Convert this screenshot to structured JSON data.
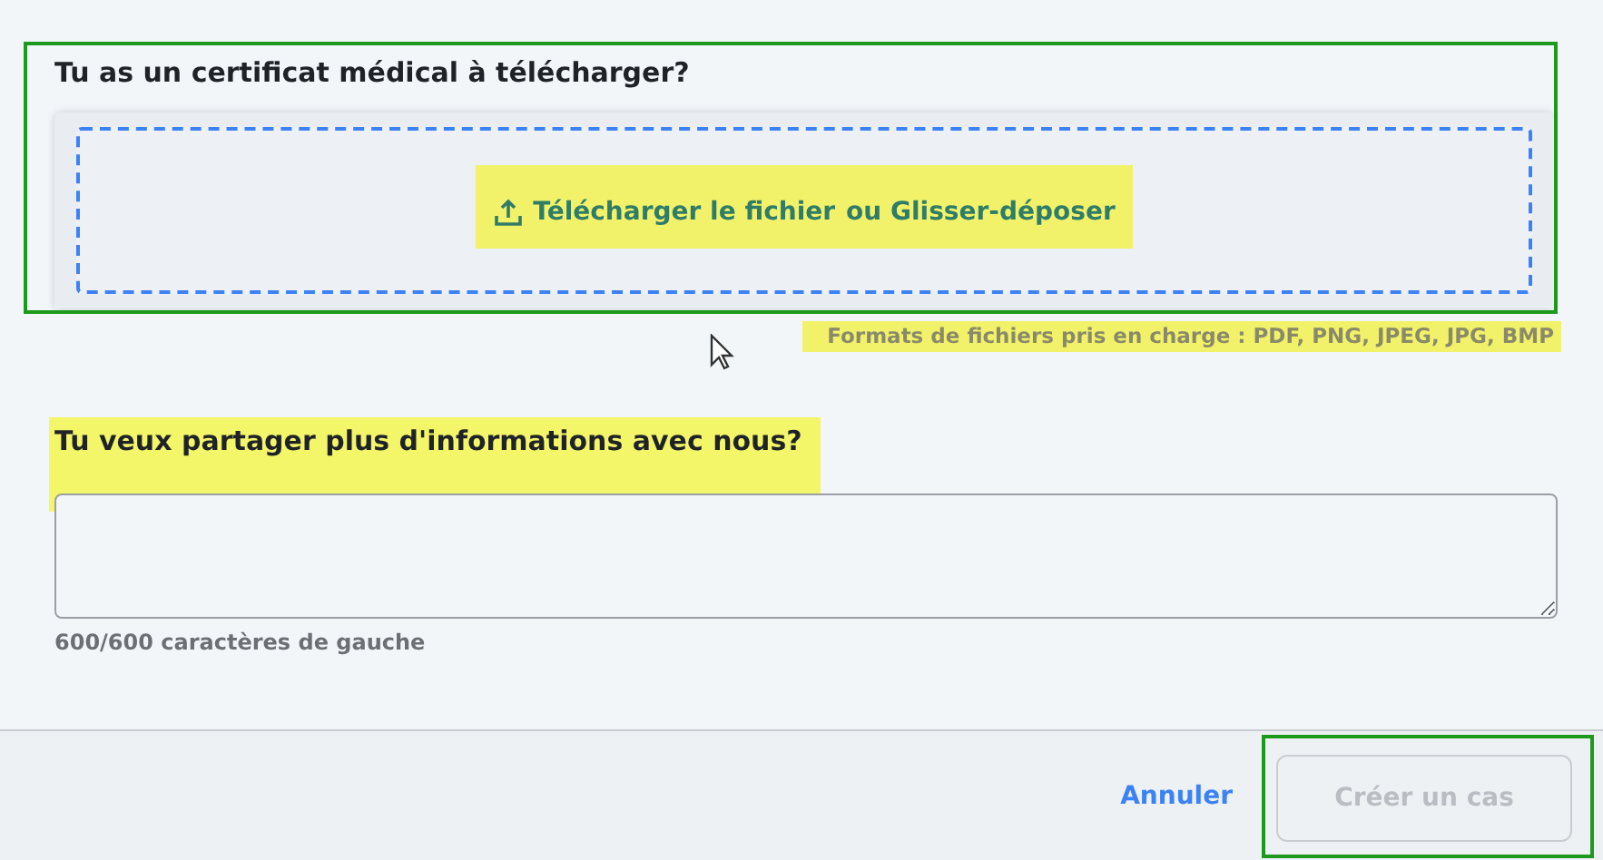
{
  "upload": {
    "heading": "Tu as un certificat médical à télécharger?",
    "action": "Télécharger le fichier",
    "alternative": "ou Glisser-déposer",
    "formats": "Formats de fichiers pris en charge : PDF, PNG, JPEG, JPG, BMP"
  },
  "details": {
    "heading": "Tu veux partager plus d'informations avec nous?",
    "counter": "600/600 caractères de gauche"
  },
  "footer": {
    "cancel": "Annuler",
    "submit": {
      "label": "Créer un cas",
      "disabled": true
    }
  }
}
